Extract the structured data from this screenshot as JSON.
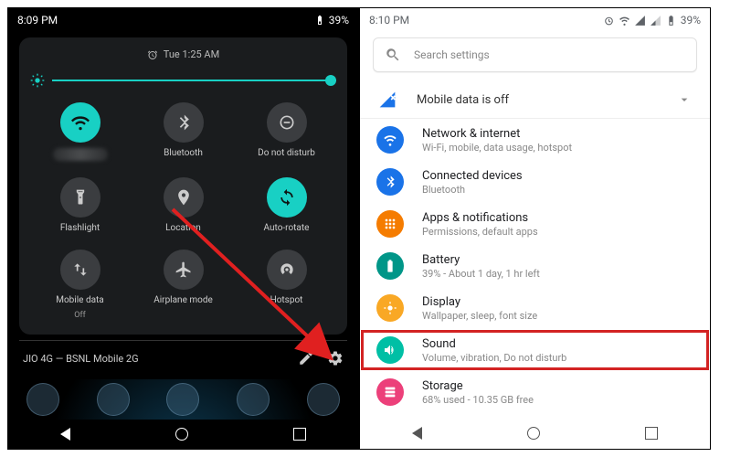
{
  "left": {
    "status": {
      "time": "8:09 PM",
      "battery": "39%"
    },
    "alarm": "Tue 1:25 AM",
    "tiles": [
      {
        "label": "",
        "sublabel": "",
        "icon": "wifi",
        "active": true
      },
      {
        "label": "Bluetooth",
        "sublabel": "",
        "icon": "bluetooth",
        "active": false
      },
      {
        "label": "Do not disturb",
        "sublabel": "",
        "icon": "dnd",
        "active": false
      },
      {
        "label": "Flashlight",
        "sublabel": "",
        "icon": "flashlight",
        "active": false
      },
      {
        "label": "Location",
        "sublabel": "",
        "icon": "location",
        "active": false
      },
      {
        "label": "Auto-rotate",
        "sublabel": "",
        "icon": "rotate",
        "active": true
      },
      {
        "label": "Mobile data",
        "sublabel": "Off",
        "icon": "mobiledata",
        "active": false
      },
      {
        "label": "Airplane mode",
        "sublabel": "",
        "icon": "airplane",
        "active": false
      },
      {
        "label": "Hotspot",
        "sublabel": "",
        "icon": "hotspot",
        "active": false
      }
    ],
    "carrier": "JIO 4G — BSNL Mobile 2G"
  },
  "right": {
    "status": {
      "time": "8:10 PM",
      "battery": "39%"
    },
    "search_placeholder": "Search settings",
    "suggestion": "Mobile data is off",
    "rows": [
      {
        "title": "Network & internet",
        "sub": "Wi-Fi, mobile, data usage, hotspot",
        "color": "#1a73e8",
        "icon": "wifi"
      },
      {
        "title": "Connected devices",
        "sub": "Bluetooth",
        "color": "#1a73e8",
        "icon": "bluetooth"
      },
      {
        "title": "Apps & notifications",
        "sub": "Permissions, default apps",
        "color": "#f57c00",
        "icon": "apps"
      },
      {
        "title": "Battery",
        "sub": "39% - About 1 day, 1 hr left",
        "color": "#009688",
        "icon": "battery"
      },
      {
        "title": "Display",
        "sub": "Wallpaper, sleep, font size",
        "color": "#f9a825",
        "icon": "display"
      },
      {
        "title": "Sound",
        "sub": "Volume, vibration, Do not disturb",
        "color": "#00bfa5",
        "icon": "sound",
        "highlight": true
      },
      {
        "title": "Storage",
        "sub": "68% used - 10.35 GB free",
        "color": "#ec407a",
        "icon": "storage"
      }
    ]
  }
}
